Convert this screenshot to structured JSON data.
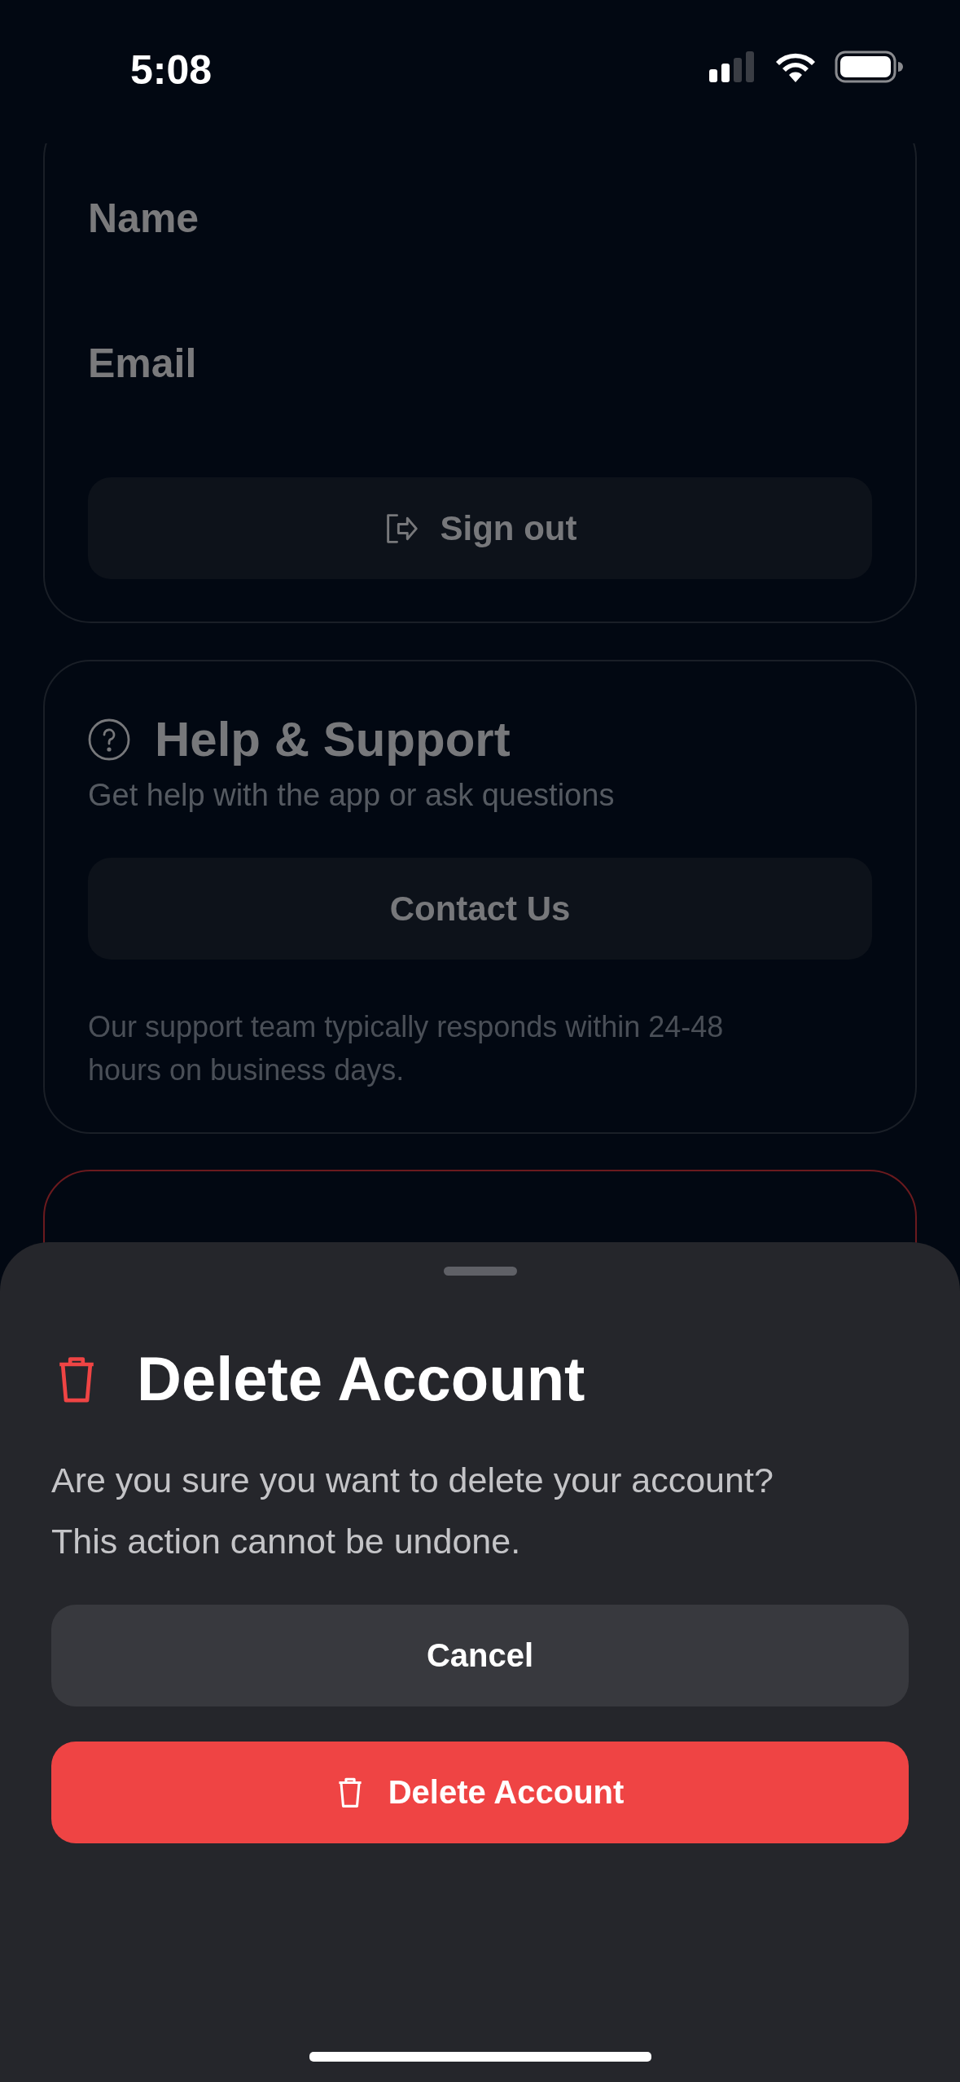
{
  "status_bar": {
    "time": "5:08"
  },
  "account_card": {
    "fields": [
      {
        "label": "Name"
      },
      {
        "label": "Email"
      }
    ],
    "sign_out_button": "Sign out"
  },
  "help_card": {
    "title": "Help & Support",
    "subtitle": "Get help with the app or ask questions",
    "contact_button": "Contact Us",
    "note": "Our support team typically responds within 24-48 hours on business days."
  },
  "sheet": {
    "title": "Delete Account",
    "message": "Are you sure you want to delete your account? This action cannot be undone.",
    "buttons": [
      {
        "kind": "secondary",
        "label": "Cancel"
      },
      {
        "kind": "destructive",
        "label": "Delete Account"
      }
    ]
  }
}
